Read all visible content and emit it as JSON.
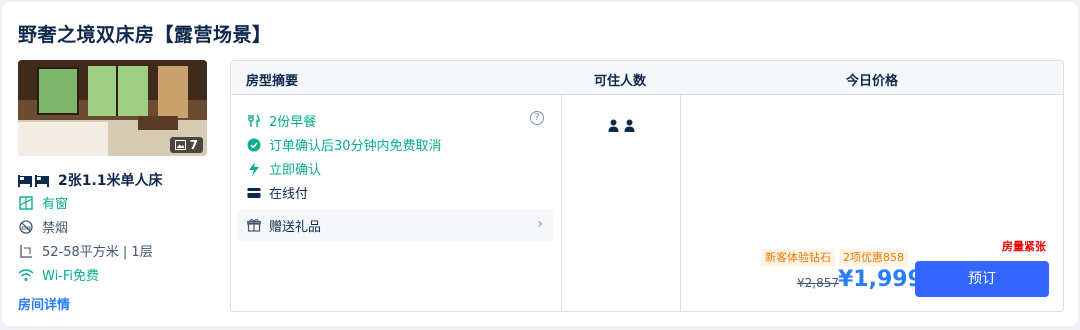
{
  "room": {
    "title": "野奢之境双床房【露营场景】",
    "photo_count": "7",
    "bed": "2张1.1米单人床",
    "features": [
      {
        "icon": "window-icon",
        "label": "有窗",
        "accent": true
      },
      {
        "icon": "no-smoking-icon",
        "label": "禁烟",
        "accent": false
      },
      {
        "icon": "area-icon",
        "label": "52-58平方米 | 1层",
        "accent": false
      },
      {
        "icon": "wifi-icon",
        "label": "Wi-Fi免费",
        "accent": true
      }
    ],
    "details_link": "房间详情"
  },
  "table": {
    "headers": {
      "summary": "房型摘要",
      "occupancy": "可住人数",
      "price": "今日价格"
    }
  },
  "rate": {
    "perks": [
      {
        "icon": "breakfast-icon",
        "label": "2份早餐",
        "style": "green"
      },
      {
        "icon": "check-circle-icon",
        "label": "订单确认后30分钟内免费取消",
        "style": "green"
      },
      {
        "icon": "lightning-icon",
        "label": "立即确认",
        "style": "green"
      },
      {
        "icon": "card-icon",
        "label": "在线付",
        "style": "dark"
      }
    ],
    "help_mark": "?",
    "gift": "赠送礼品",
    "occupancy_count": 2,
    "urgency": "房量紧张",
    "tags": [
      "新客体验钻石",
      "2项优惠858"
    ],
    "original_price": "¥2,857",
    "price": "¥1,999",
    "book_button": "预订"
  },
  "colors": {
    "accent": "#287dfa",
    "green": "#06ae8e",
    "button": "#3366ff",
    "urgent": "#ee0000",
    "tag": "#f07800"
  }
}
